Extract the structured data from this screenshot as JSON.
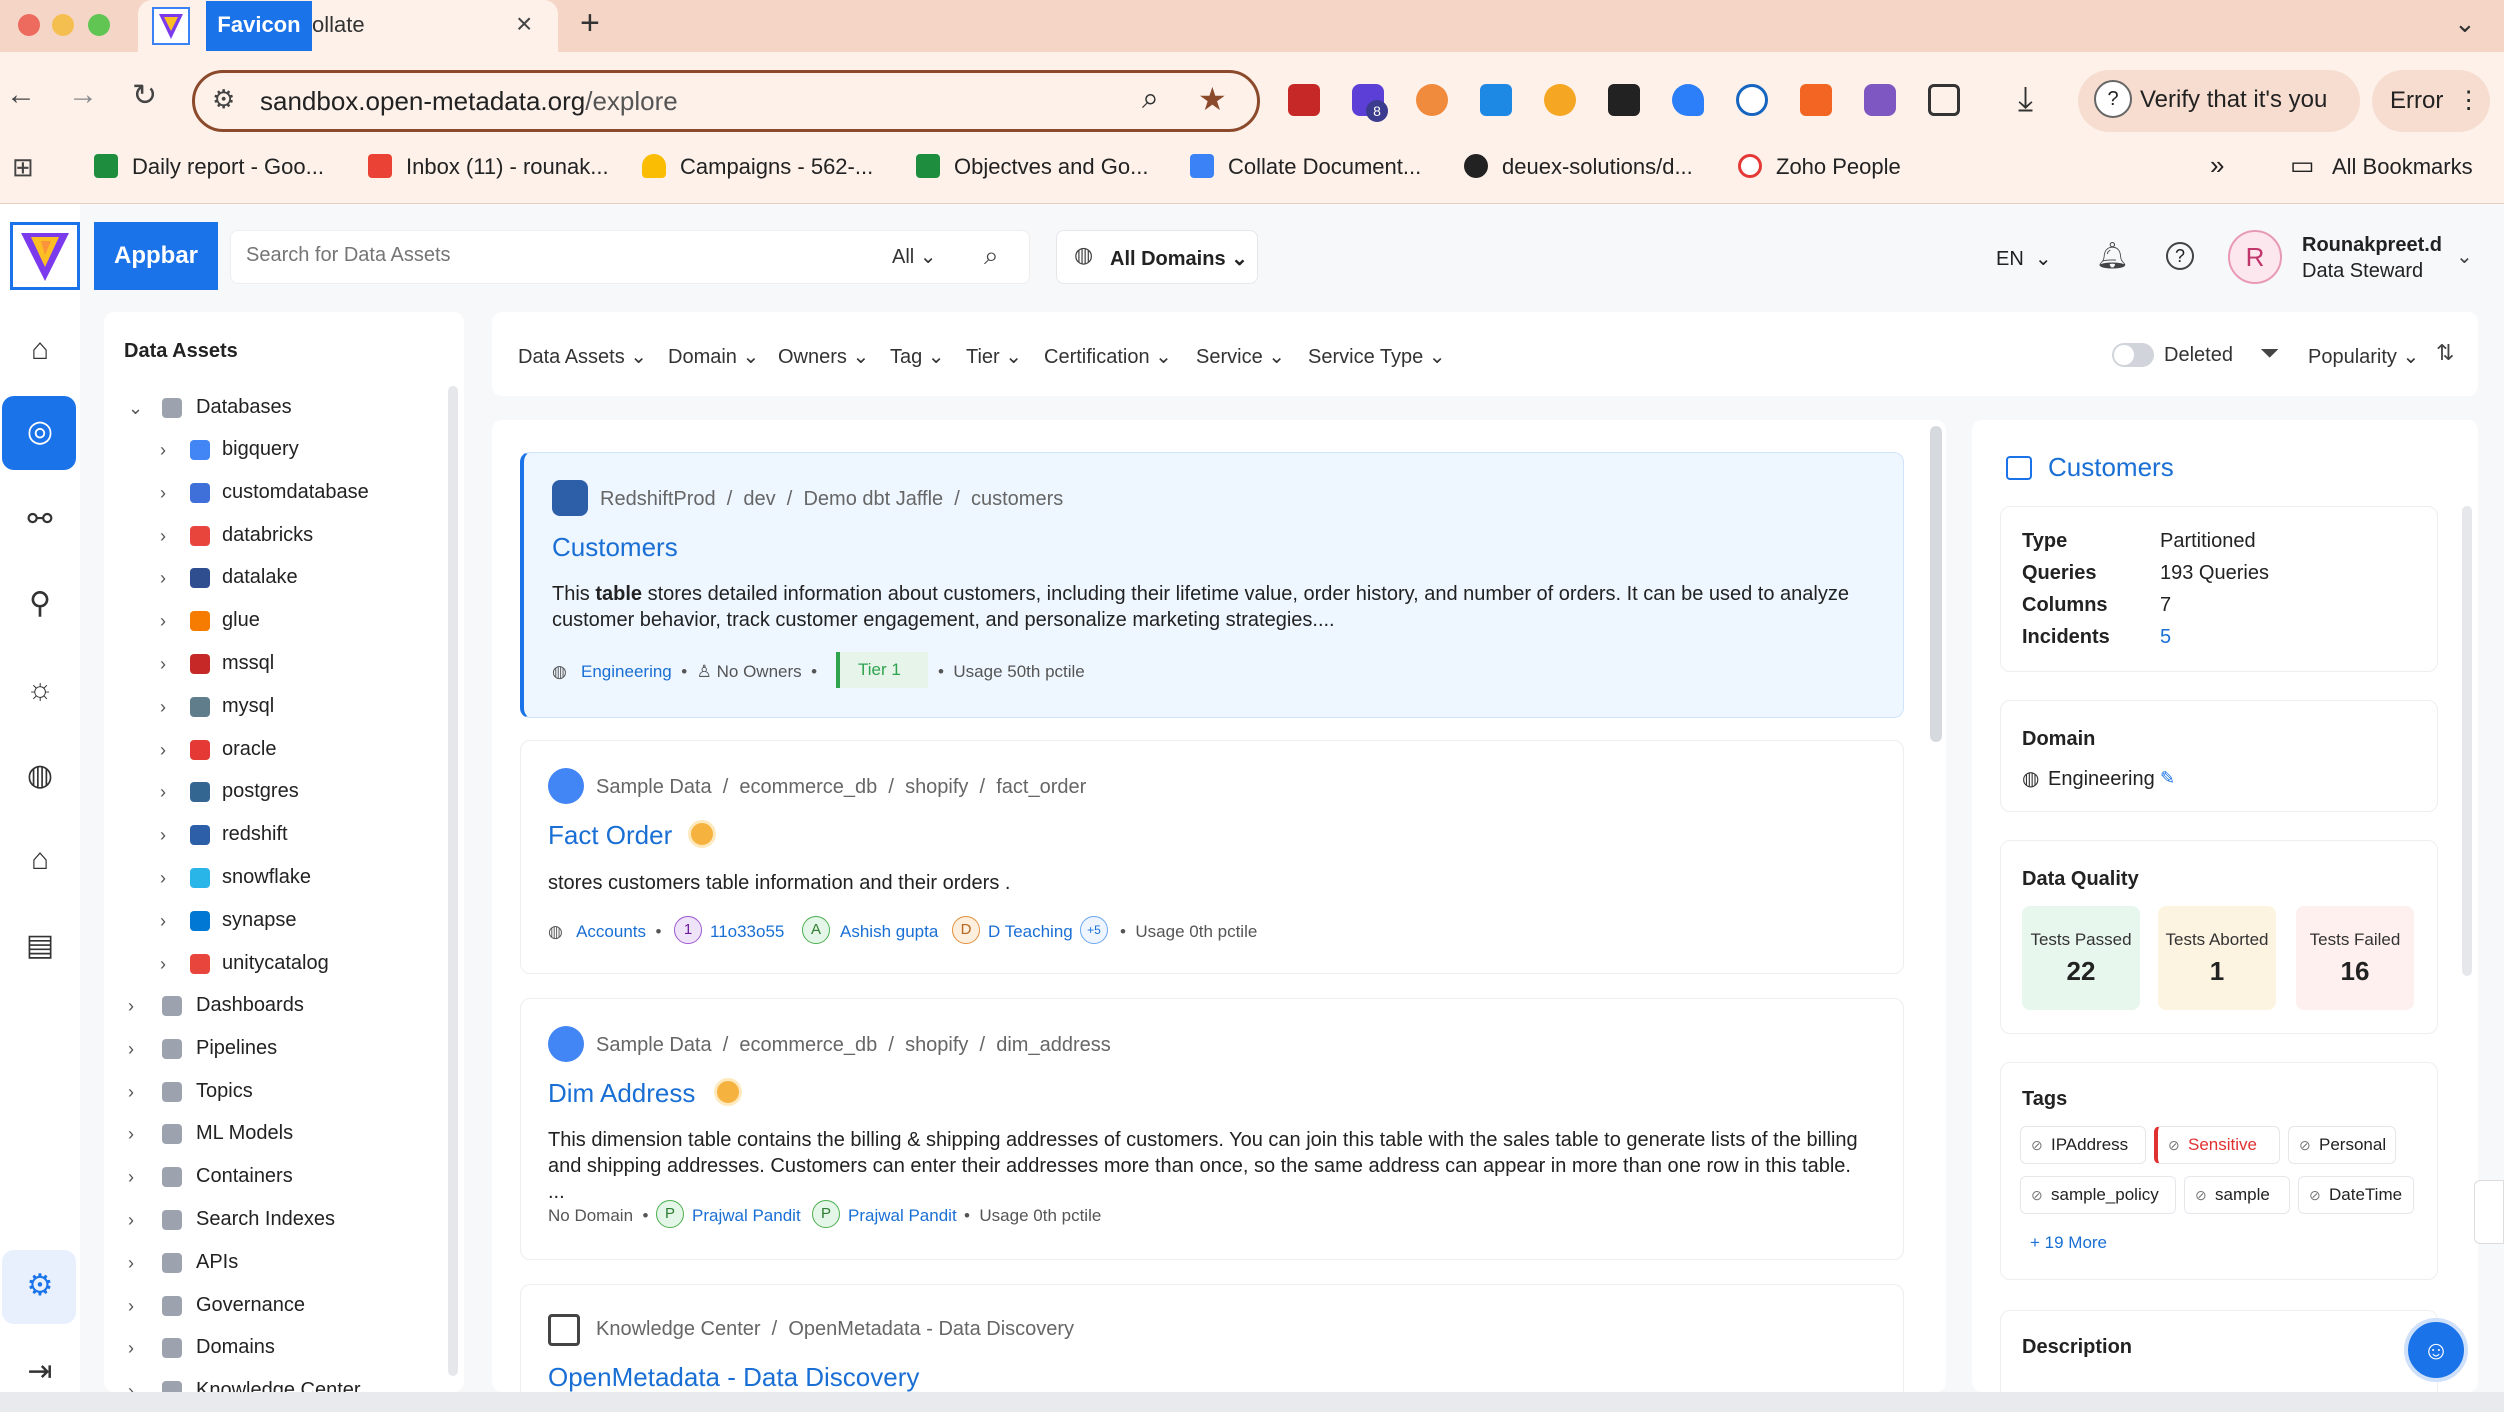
{
  "browser": {
    "tab_favicon_label": "Favicon",
    "tab_title_rest": "ollate",
    "url_host": "sandbox.open-metadata.org",
    "url_path": "/explore",
    "verify_label": "Verify that it's you",
    "error_label": "Error",
    "bookmarks": [
      "Daily report - Goo...",
      "Inbox (11) - rounak...",
      "Campaigns - 562-...",
      "Objectves and Go...",
      "Collate Document...",
      "deuex-solutions/d...",
      "Zoho People"
    ],
    "all_bookmarks": "All Bookmarks",
    "ext_badge": "8"
  },
  "header": {
    "appbar_label": "Appbar",
    "search_placeholder": "Search for Data Assets",
    "search_scope": "All",
    "domains_label": "All Domains",
    "language": "EN",
    "avatar_initial": "R",
    "user_name": "Rounakpreet.d",
    "user_role": "Data Steward"
  },
  "tree": {
    "title": "Data Assets",
    "databases_label": "Databases",
    "services": [
      "bigquery",
      "customdatabase",
      "databricks",
      "datalake",
      "glue",
      "mssql",
      "mysql",
      "oracle",
      "postgres",
      "redshift",
      "snowflake",
      "synapse",
      "unitycatalog"
    ],
    "categories": [
      "Dashboards",
      "Pipelines",
      "Topics",
      "ML Models",
      "Containers",
      "Search Indexes",
      "APIs",
      "Governance",
      "Domains",
      "Knowledge Center"
    ]
  },
  "filters": [
    "Data Assets",
    "Domain",
    "Owners",
    "Tag",
    "Tier",
    "Certification",
    "Service",
    "Service Type"
  ],
  "deleted_label": "Deleted",
  "sort_label": "Popularity",
  "results": [
    {
      "crumbs": [
        "RedshiftProd",
        "dev",
        "Demo dbt Jaffle",
        "customers"
      ],
      "title": "Customers",
      "desc_pre": "This ",
      "desc_bold": "table",
      "desc_post": " stores detailed information about customers, including their lifetime value, order history, and number of orders. It can be used to analyze customer behavior, track customer engagement, and personalize marketing strategies....",
      "domain": "Engineering",
      "owners": "No Owners",
      "tier": "Tier 1",
      "usage": "Usage 50th pctile"
    },
    {
      "crumbs": [
        "Sample Data",
        "ecommerce_db",
        "shopify",
        "fact_order"
      ],
      "title": "Fact Order",
      "desc": "stores customers table information and their orders .",
      "domain": "Accounts",
      "owner1_initial": "1",
      "owner1": "11o33o55",
      "owner2_initial": "A",
      "owner2": "Ashish gupta",
      "owner3_initial": "D",
      "owner3": "D Teaching",
      "more": "+5",
      "usage": "Usage 0th pctile"
    },
    {
      "crumbs": [
        "Sample Data",
        "ecommerce_db",
        "shopify",
        "dim_address"
      ],
      "title": "Dim Address",
      "desc": "This dimension table contains the billing & shipping addresses of customers. You can join this table with the sales table to generate lists of the billing and shipping addresses. Customers can enter their addresses more than once, so the same address can appear in more than one row in this table. ...",
      "domain": "No Domain",
      "owner1_initial": "P",
      "owner1": "Prajwal Pandit",
      "owner2_initial": "P",
      "owner2": "Prajwal Pandit",
      "usage": "Usage 0th pctile"
    },
    {
      "crumbs": [
        "Knowledge Center",
        "OpenMetadata - Data Discovery"
      ],
      "title": "OpenMetadata - Data Discovery"
    }
  ],
  "details": {
    "title": "Customers",
    "rows": [
      {
        "k": "Type",
        "v": "Partitioned"
      },
      {
        "k": "Queries",
        "v": "193 Queries"
      },
      {
        "k": "Columns",
        "v": "7"
      },
      {
        "k": "Incidents",
        "v": "5"
      }
    ],
    "domain_heading": "Domain",
    "domain_value": "Engineering",
    "dq_heading": "Data Quality",
    "dq": [
      {
        "label": "Tests Passed",
        "value": "22"
      },
      {
        "label": "Tests Aborted",
        "value": "1"
      },
      {
        "label": "Tests Failed",
        "value": "16"
      }
    ],
    "tags_heading": "Tags",
    "tags": [
      "IPAddress",
      "Sensitive",
      "Personal",
      "sample_policy",
      "sample",
      "DateTime"
    ],
    "more_tags": "+ 19 More",
    "description_heading": "Description"
  },
  "colors": {
    "accent": "#1a73e8",
    "chrome": "#fdf1ea",
    "tier": "#2ea44f",
    "sensitive": "#e03131"
  }
}
